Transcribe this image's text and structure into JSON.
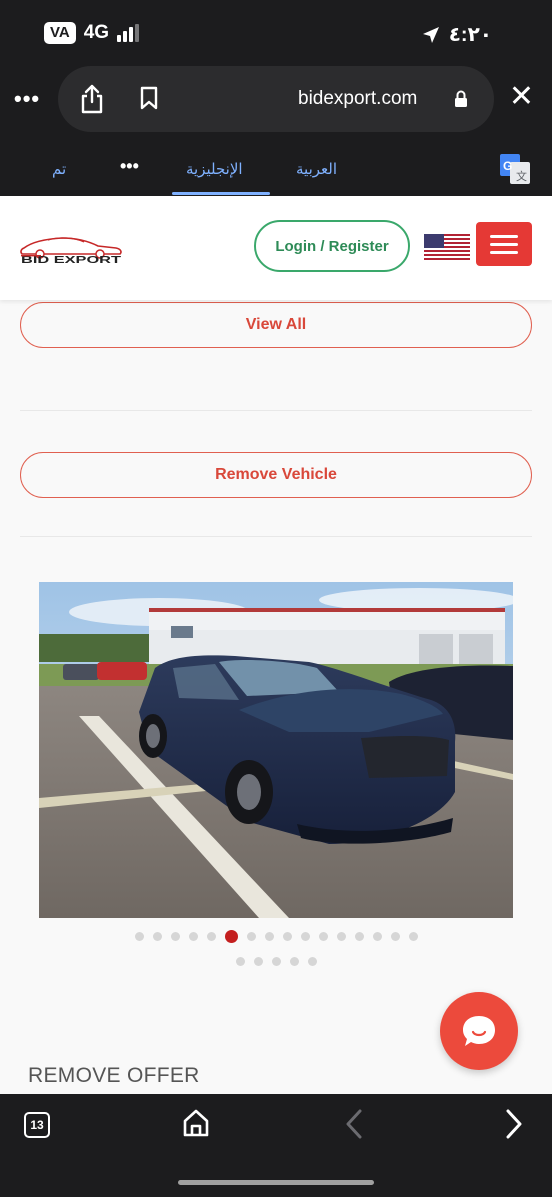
{
  "status_bar": {
    "battery": "VA",
    "network": "4G",
    "time": "٤:٢٠"
  },
  "browser": {
    "domain": "bidexport.com",
    "more_label": "•••",
    "close_label": "✕"
  },
  "translate": {
    "done": "تم",
    "more": "•••",
    "english": "الإنجليزية",
    "arabic": "العربية"
  },
  "header": {
    "logo_text": "BID EXPORT",
    "login_label": "Login / Register"
  },
  "buttons": {
    "view_all": "View All",
    "remove_vehicle": "Remove Vehicle"
  },
  "carousel": {
    "row1_count": 16,
    "row2_count": 5,
    "active_index": 5
  },
  "remove_offer": "REMOVE OFFER",
  "bottom_bar": {
    "tab_count": "13"
  },
  "colors": {
    "accent_red": "#e53935",
    "login_green": "#3aa86b",
    "active_dot": "#c41f1f",
    "chat_bubble": "#ec4a3c"
  }
}
